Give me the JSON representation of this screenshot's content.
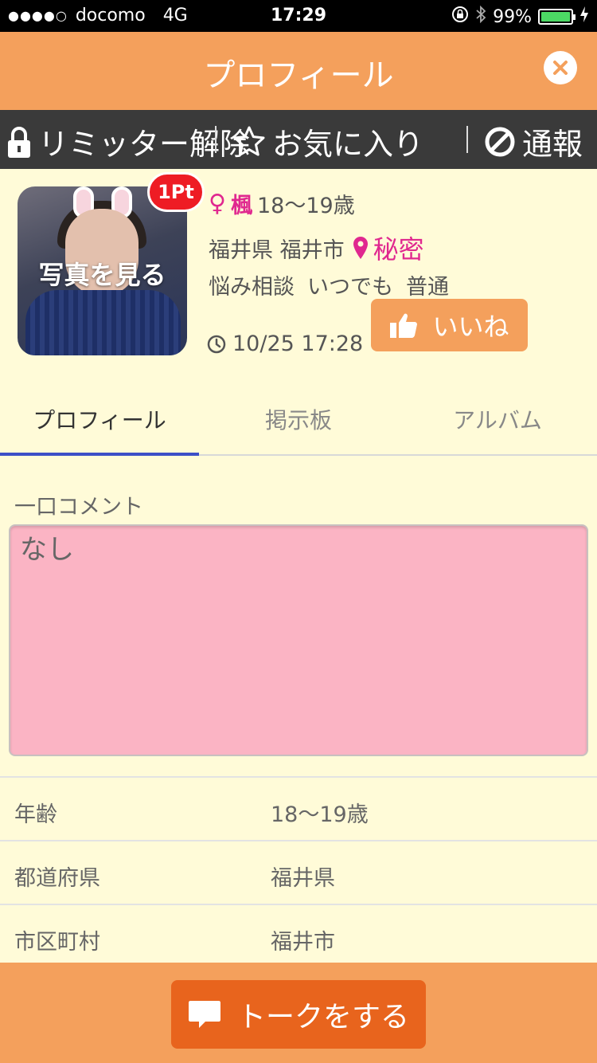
{
  "status_bar": {
    "signal": "●●●●○",
    "carrier": "docomo",
    "network": "4G",
    "time": "17:29",
    "battery": "99%"
  },
  "header": {
    "title": "プロフィール"
  },
  "action_bar": {
    "limiter_label": "リミッター解除",
    "favorite_label": "お気に入り",
    "report_label": "通報"
  },
  "profile": {
    "photo_label": "写真を見る",
    "point_badge": "1Pt",
    "gender_symbol": "♀",
    "name": "楓",
    "age": "18〜19歳",
    "location": "福井県 福井市",
    "location_secret": "秘密",
    "purpose": "悩み相談",
    "availability": "いつでも",
    "style": "普通",
    "last_login": "10/25 17:28",
    "like_label": "いいね"
  },
  "tabs": [
    {
      "label": "プロフィール",
      "active": true
    },
    {
      "label": "掲示板",
      "active": false
    },
    {
      "label": "アルバム",
      "active": false
    }
  ],
  "comment": {
    "label": "一口コメント",
    "text": "なし"
  },
  "details": [
    {
      "key": "年齢",
      "value": "18〜19歳"
    },
    {
      "key": "都道府県",
      "value": "福井県"
    },
    {
      "key": "市区町村",
      "value": "福井市"
    }
  ],
  "footer": {
    "talk_label": "トークをする"
  },
  "colors": {
    "accent_orange": "#f4a05c",
    "talk_button": "#e8641d",
    "pink_text": "#e0288f",
    "comment_bg": "#fbb4c4",
    "tab_underline": "#3c4fc7",
    "background": "#fffbd8"
  }
}
